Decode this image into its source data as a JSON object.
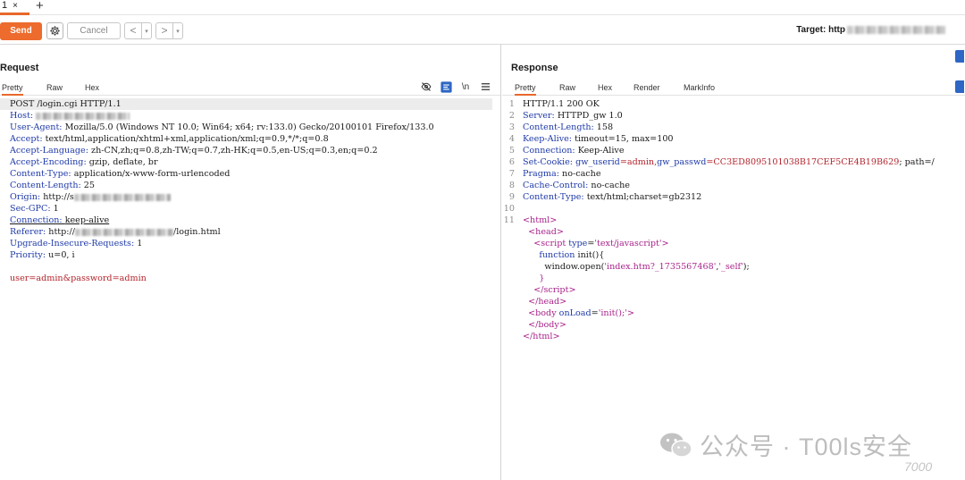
{
  "tabs": {
    "active_label": "1",
    "close": "×",
    "add": "+"
  },
  "toolbar": {
    "send_label": "Send",
    "cancel_label": "Cancel",
    "back": "<",
    "forward": ">",
    "dropdown": "▾",
    "target_label": "Target: http"
  },
  "request": {
    "title": "Request",
    "tabs": [
      "Pretty",
      "Raw",
      "Hex"
    ],
    "newline_icon": "\\n",
    "lines": [
      [
        {
          "t": "POST /login.cgi HTTP/1.1",
          "c": "hv"
        }
      ],
      [
        {
          "t": "Host: ",
          "c": "hk"
        }
      ],
      [
        {
          "t": "User-Agent: ",
          "c": "hk"
        },
        {
          "t": "Mozilla/5.0 (Windows NT 10.0; Win64; x64; rv:133.0) Gecko/20100101 Firefox/133.0",
          "c": "hv"
        }
      ],
      [
        {
          "t": "Accept: ",
          "c": "hk"
        },
        {
          "t": "text/html,application/xhtml+xml,application/xml;q=0.9,*/*;q=0.8",
          "c": "hv"
        }
      ],
      [
        {
          "t": "Accept-Language: ",
          "c": "hk"
        },
        {
          "t": "zh-CN,zh;q=0.8,zh-TW;q=0.7,zh-HK;q=0.5,en-US;q=0.3,en;q=0.2",
          "c": "hv"
        }
      ],
      [
        {
          "t": "Accept-Encoding: ",
          "c": "hk"
        },
        {
          "t": "gzip, deflate, br",
          "c": "hv"
        }
      ],
      [
        {
          "t": "Content-Type: ",
          "c": "hk"
        },
        {
          "t": "application/x-www-form-urlencoded",
          "c": "hv"
        }
      ],
      [
        {
          "t": "Content-Length: ",
          "c": "hk"
        },
        {
          "t": "25",
          "c": "hv"
        }
      ],
      [
        {
          "t": "Origin: ",
          "c": "hk"
        },
        {
          "t": "http://s",
          "c": "hv"
        }
      ],
      [
        {
          "t": "Sec-GPC: ",
          "c": "hk"
        },
        {
          "t": "1",
          "c": "hv"
        }
      ],
      [
        {
          "t": "Connection: ",
          "c": "hk"
        },
        {
          "t": "keep-alive",
          "c": "hv"
        }
      ],
      [
        {
          "t": "Referer: ",
          "c": "hk"
        },
        {
          "t": "http://",
          "c": "hv"
        },
        {
          "t": "/login.html",
          "c": "hv"
        }
      ],
      [
        {
          "t": "Upgrade-Insecure-Requests: ",
          "c": "hk"
        },
        {
          "t": "1",
          "c": "hv"
        }
      ],
      [
        {
          "t": "Priority: ",
          "c": "hk"
        },
        {
          "t": "u=0, i",
          "c": "hv"
        }
      ],
      [],
      [
        {
          "t": "user=admin&password=admin",
          "c": "red"
        }
      ]
    ]
  },
  "response": {
    "title": "Response",
    "tabs": [
      "Pretty",
      "Raw",
      "Hex",
      "Render",
      "MarkInfo"
    ],
    "lines": [
      [
        {
          "t": "HTTP/1.1 200 OK",
          "c": "hv"
        }
      ],
      [
        {
          "t": "Server: ",
          "c": "hk"
        },
        {
          "t": "HTTPD_gw 1.0",
          "c": "hv"
        }
      ],
      [
        {
          "t": "Content-Length: ",
          "c": "hk"
        },
        {
          "t": "158",
          "c": "hv"
        }
      ],
      [
        {
          "t": "Keep-Alive: ",
          "c": "hk"
        },
        {
          "t": "timeout=15, max=100",
          "c": "hv"
        }
      ],
      [
        {
          "t": "Connection: ",
          "c": "hk"
        },
        {
          "t": "Keep-Alive",
          "c": "hv"
        }
      ],
      [
        {
          "t": "Set-Cookie: ",
          "c": "hk"
        },
        {
          "t": "gw_userid",
          "c": "kw"
        },
        {
          "t": "=admin,",
          "c": "red"
        },
        {
          "t": "gw_passwd",
          "c": "kw"
        },
        {
          "t": "=CC3ED8095101038B17CEF5CE4B19B629",
          "c": "red"
        },
        {
          "t": "; path=/",
          "c": "hv"
        }
      ],
      [
        {
          "t": "Pragma: ",
          "c": "hk"
        },
        {
          "t": "no-cache",
          "c": "hv"
        }
      ],
      [
        {
          "t": "Cache-Control: ",
          "c": "hk"
        },
        {
          "t": "no-cache",
          "c": "hv"
        }
      ],
      [
        {
          "t": "Content-Type: ",
          "c": "hk"
        },
        {
          "t": "text/html;charset=gb2312",
          "c": "hv"
        }
      ],
      [],
      [
        {
          "t": "<html>",
          "c": "tag"
        }
      ],
      [
        {
          "t": "  <head>",
          "c": "tag"
        }
      ],
      [
        {
          "t": "    <script ",
          "c": "tag"
        },
        {
          "t": "type",
          "c": "attr"
        },
        {
          "t": "=",
          "c": "hv"
        },
        {
          "t": "'text/javascript'",
          "c": "str"
        },
        {
          "t": ">",
          "c": "tag"
        }
      ],
      [
        {
          "t": "      ",
          "c": "hv"
        },
        {
          "t": "function",
          "c": "kw"
        },
        {
          "t": " init(){",
          "c": "fn"
        }
      ],
      [
        {
          "t": "        window.open(",
          "c": "fn"
        },
        {
          "t": "'index.htm?_1735567468'",
          "c": "str"
        },
        {
          "t": ",",
          "c": "fn"
        },
        {
          "t": "'_self'",
          "c": "str"
        },
        {
          "t": ");",
          "c": "fn"
        }
      ],
      [
        {
          "t": "      }",
          "c": "tag"
        }
      ],
      [
        {
          "t": "    </",
          "c": "tag"
        },
        {
          "t": "script",
          "c": "tag"
        },
        {
          "t": ">",
          "c": "tag"
        }
      ],
      [
        {
          "t": "  </head>",
          "c": "tag"
        }
      ],
      [
        {
          "t": "  <body ",
          "c": "tag"
        },
        {
          "t": "onLoad",
          "c": "attr"
        },
        {
          "t": "=",
          "c": "hv"
        },
        {
          "t": "'init();'",
          "c": "str"
        },
        {
          "t": ">",
          "c": "tag"
        }
      ],
      [
        {
          "t": "  </body>",
          "c": "tag"
        }
      ],
      [
        {
          "t": "</html>",
          "c": "tag"
        }
      ]
    ],
    "line_numbers": [
      "1",
      "2",
      "3",
      "4",
      "5",
      "6",
      "7",
      "8",
      "9",
      "10",
      "11"
    ]
  },
  "watermark": {
    "text": "公众号 · T00ls安全",
    "sub": "7000"
  },
  "colors": {
    "accent": "#ec6b2d",
    "header_key": "#1f3aa8",
    "tag": "#a8238a",
    "value_red": "#b2242c"
  }
}
